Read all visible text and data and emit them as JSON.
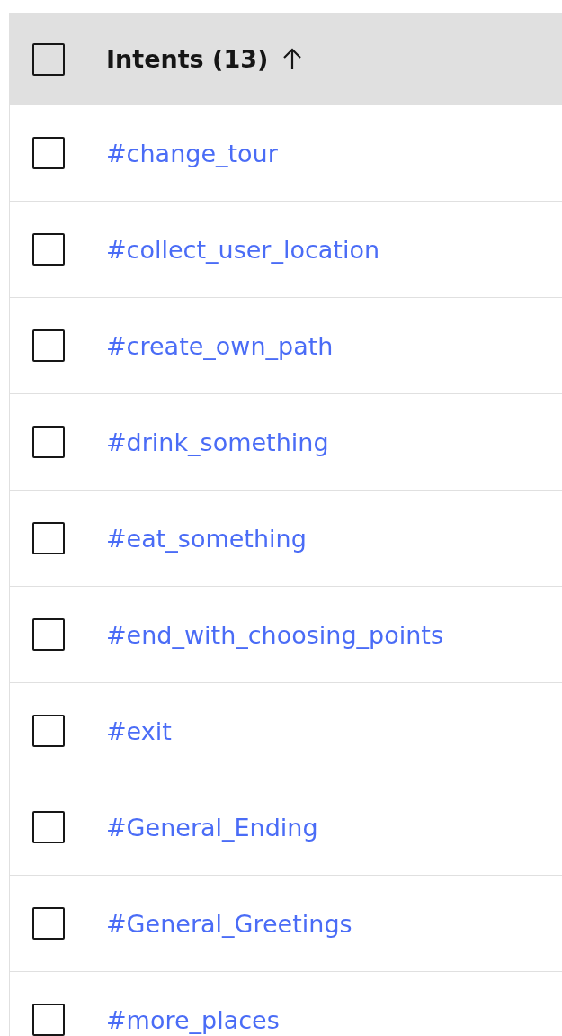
{
  "table": {
    "header": {
      "label": "Intents (13)",
      "checked": false,
      "sort_ascending": true
    },
    "rows": [
      {
        "name": "#change_tour",
        "checked": false
      },
      {
        "name": "#collect_user_location",
        "checked": false
      },
      {
        "name": "#create_own_path",
        "checked": false
      },
      {
        "name": "#drink_something",
        "checked": false
      },
      {
        "name": "#eat_something",
        "checked": false
      },
      {
        "name": "#end_with_choosing_points",
        "checked": false
      },
      {
        "name": "#exit",
        "checked": false
      },
      {
        "name": "#General_Ending",
        "checked": false
      },
      {
        "name": "#General_Greetings",
        "checked": false
      },
      {
        "name": "#more_places",
        "checked": false
      }
    ]
  }
}
